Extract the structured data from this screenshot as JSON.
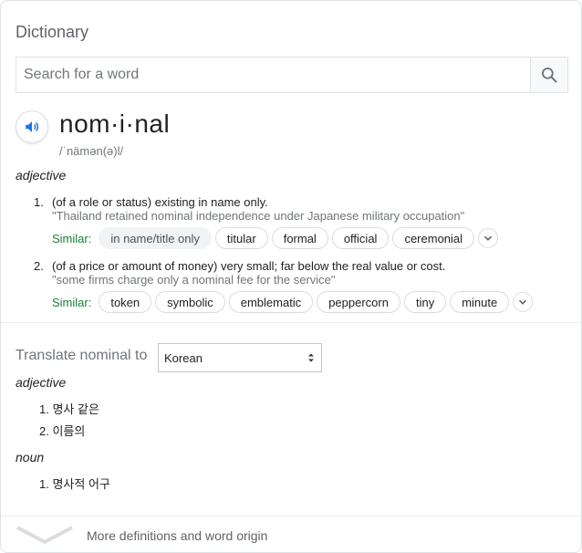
{
  "header": {
    "title": "Dictionary"
  },
  "search": {
    "placeholder": "Search for a word",
    "value": ""
  },
  "entry": {
    "word": "nom·i·nal",
    "phonetic": "/ˈnämən(ə)l/",
    "pos": "adjective",
    "definitions": [
      {
        "num": "1.",
        "text": "(of a role or status) existing in name only.",
        "example": "\"Thailand retained nominal independence under Japanese military occupation\"",
        "similar_label": "Similar:",
        "similar": [
          "in name/title only",
          "titular",
          "formal",
          "official",
          "ceremonial"
        ]
      },
      {
        "num": "2.",
        "text": "(of a price or amount of money) very small; far below the real value or cost.",
        "example": "\"some firms charge only a nominal fee for the service\"",
        "similar_label": "Similar:",
        "similar": [
          "token",
          "symbolic",
          "emblematic",
          "peppercorn",
          "tiny",
          "minute"
        ]
      }
    ]
  },
  "translate": {
    "label": "Translate nominal to",
    "language": "Korean",
    "sections": [
      {
        "pos": "adjective",
        "items": [
          "1. 명사 같은",
          "2. 이름의"
        ]
      },
      {
        "pos": "noun",
        "items": [
          "1. 명사적 어구"
        ]
      }
    ]
  },
  "footer": {
    "more": "More definitions and word origin"
  },
  "colors": {
    "similar_label": "#188038",
    "speaker": "#1a73e8",
    "muted": "#70757a"
  },
  "icons": {
    "search": "search-icon",
    "speaker": "speaker-icon",
    "expand": "chevron-down-icon",
    "more": "chevron-down-icon"
  }
}
